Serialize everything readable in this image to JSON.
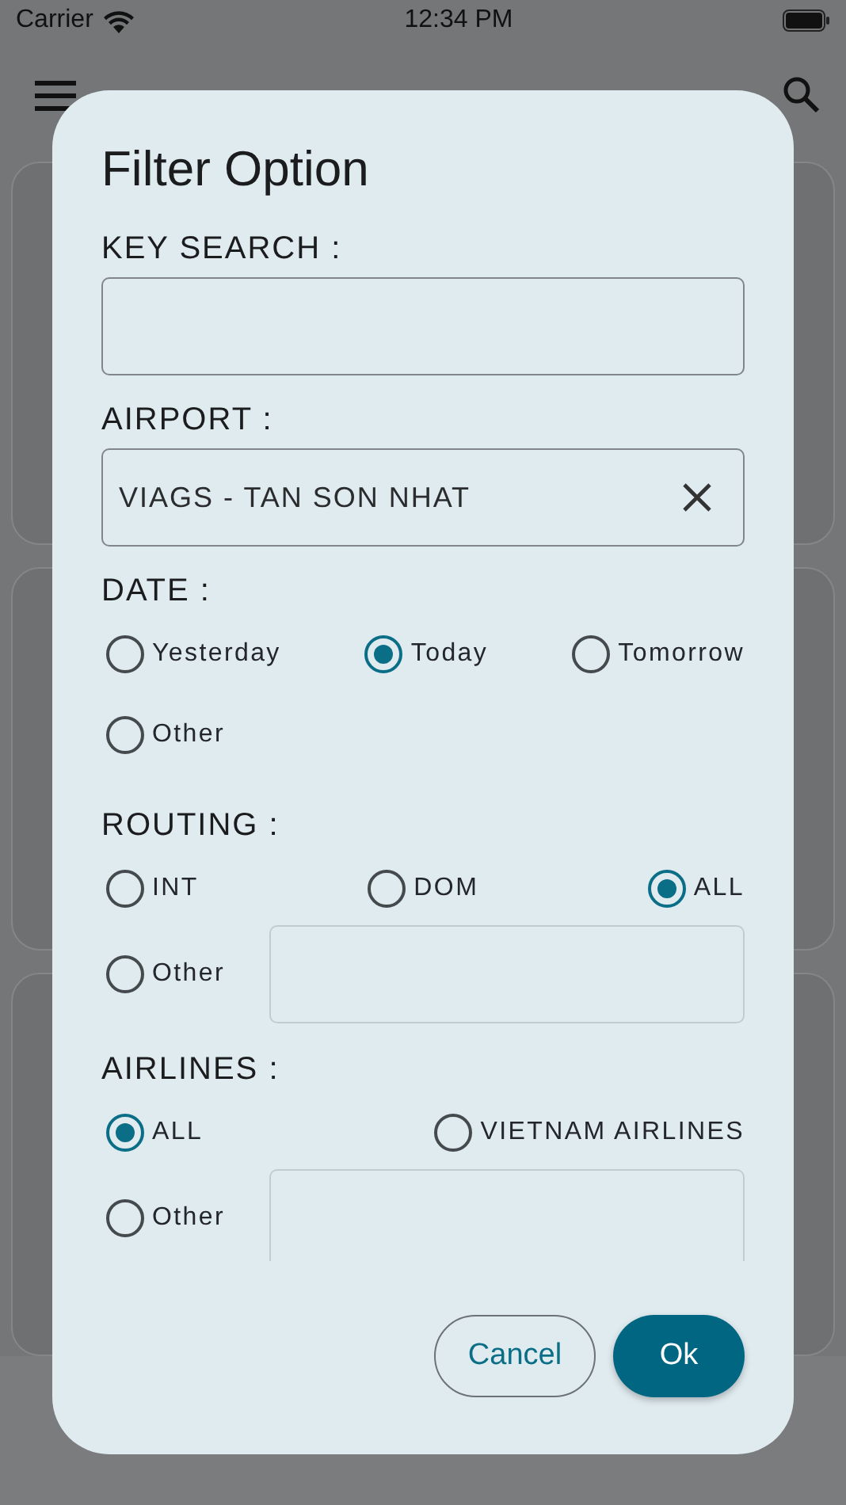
{
  "status_bar": {
    "carrier": "Carrier",
    "time": "12:34 PM"
  },
  "dialog": {
    "title": "Filter Option",
    "key_search": {
      "label": "KEY SEARCH :"
    },
    "airport": {
      "label": "AIRPORT :",
      "value": "VIAGS - TAN SON NHAT"
    },
    "date": {
      "label": "DATE :",
      "options": [
        {
          "label": "Yesterday",
          "selected": false
        },
        {
          "label": "Today",
          "selected": true
        },
        {
          "label": "Tomorrow",
          "selected": false
        }
      ],
      "other": {
        "label": "Other",
        "selected": false
      }
    },
    "routing": {
      "label": "ROUTING :",
      "options": [
        {
          "label": "INT",
          "selected": false
        },
        {
          "label": "DOM",
          "selected": false
        },
        {
          "label": "ALL",
          "selected": true
        }
      ],
      "other": {
        "label": "Other",
        "selected": false,
        "field": true
      }
    },
    "airlines": {
      "label": "AIRLINES :",
      "options": [
        {
          "label": "ALL",
          "selected": true
        },
        {
          "label": "VIETNAM AIRLINES",
          "selected": false
        }
      ],
      "other": {
        "label": "Other",
        "selected": false,
        "field": true
      }
    },
    "buttons": [
      {
        "label": "Cancel",
        "kind": "outline"
      },
      {
        "label": "Ok",
        "kind": "filled"
      }
    ]
  }
}
